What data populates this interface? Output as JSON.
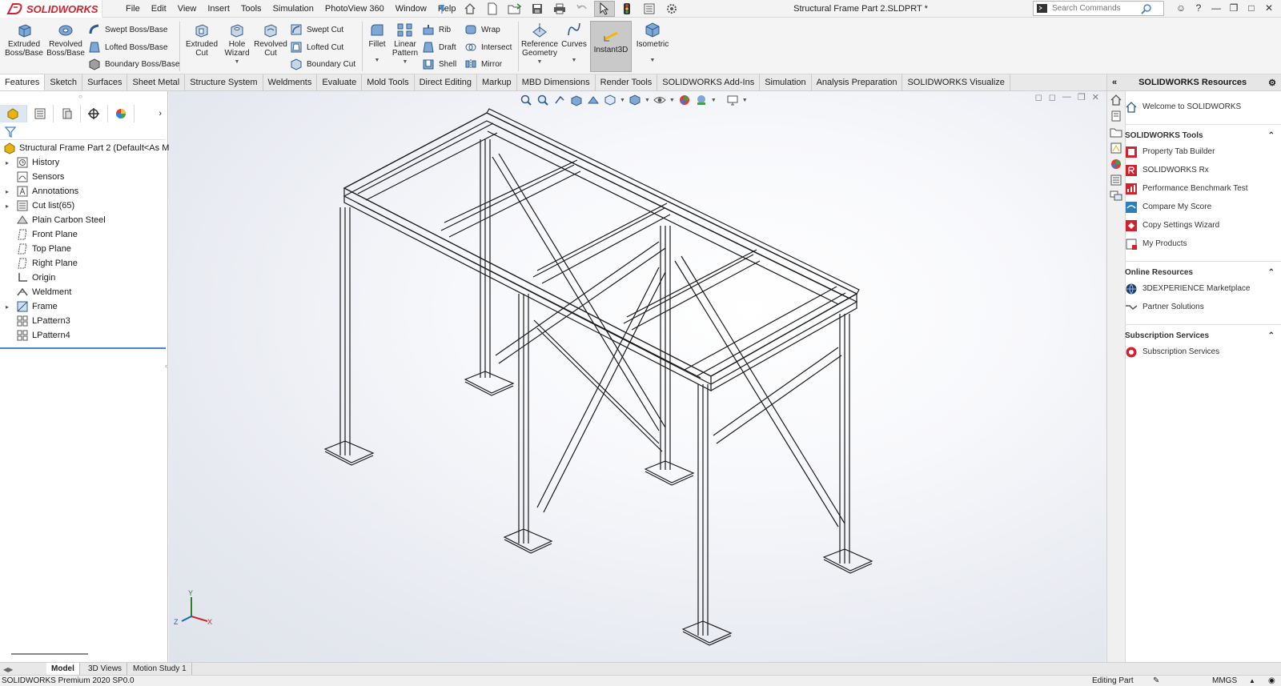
{
  "app": {
    "name": "SOLIDWORKS"
  },
  "menu": [
    "File",
    "Edit",
    "View",
    "Insert",
    "Tools",
    "Simulation",
    "PhotoView 360",
    "Window",
    "Help"
  ],
  "document_title": "Structural Frame Part 2.SLDPRT *",
  "search": {
    "placeholder": "Search Commands"
  },
  "ribbon": {
    "extruded_boss": "Extruded Boss/Base",
    "revolved_boss": "Revolved Boss/Base",
    "swept_boss": "Swept Boss/Base",
    "lofted_boss": "Lofted Boss/Base",
    "boundary_boss": "Boundary Boss/Base",
    "extruded_cut": "Extruded Cut",
    "hole_wizard": "Hole Wizard",
    "revolved_cut": "Revolved Cut",
    "swept_cut": "Swept Cut",
    "lofted_cut": "Lofted Cut",
    "boundary_cut": "Boundary Cut",
    "fillet": "Fillet",
    "linear_pattern": "Linear Pattern",
    "rib": "Rib",
    "draft": "Draft",
    "shell": "Shell",
    "wrap": "Wrap",
    "intersect": "Intersect",
    "mirror": "Mirror",
    "reference_geometry": "Reference Geometry",
    "curves": "Curves",
    "instant3d": "Instant3D",
    "isometric": "Isometric"
  },
  "tabs": [
    "Features",
    "Sketch",
    "Surfaces",
    "Sheet Metal",
    "Structure System",
    "Weldments",
    "Evaluate",
    "Mold Tools",
    "Direct Editing",
    "Markup",
    "MBD Dimensions",
    "Render Tools",
    "SOLIDWORKS Add-Ins",
    "Simulation",
    "Analysis Preparation",
    "SOLIDWORKS Visualize"
  ],
  "feature_tree": {
    "root": "Structural Frame Part 2  (Default<As Mach",
    "items": [
      "History",
      "Sensors",
      "Annotations",
      "Cut list(65)",
      "Plain Carbon Steel",
      "Front Plane",
      "Top Plane",
      "Right Plane",
      "Origin",
      "Weldment",
      "Frame",
      "LPattern3",
      "LPattern4"
    ]
  },
  "triad": {
    "y": "Y",
    "x": "X",
    "z": "Z"
  },
  "task_pane": {
    "title": "SOLIDWORKS Resources",
    "welcome": "Welcome to SOLIDWORKS",
    "tools_header": "SOLIDWORKS Tools",
    "tools": [
      "Property Tab Builder",
      "SOLIDWORKS Rx",
      "Performance Benchmark Test",
      "Compare My Score",
      "Copy Settings Wizard",
      "My Products"
    ],
    "online_header": "Online Resources",
    "online": [
      "3DEXPERIENCE Marketplace",
      "Partner Solutions"
    ],
    "subs_header": "Subscription Services",
    "subs": [
      "Subscription Services"
    ]
  },
  "bottom_tabs": [
    "Model",
    "3D Views",
    "Motion Study 1"
  ],
  "status": {
    "left": "SOLIDWORKS Premium 2020 SP0.0",
    "mode": "Editing Part",
    "units": "MMGS"
  },
  "colors": {
    "brand": "#d1222f",
    "selection": "#4a86c6",
    "instant3d_bg": "#c9c9c9"
  }
}
